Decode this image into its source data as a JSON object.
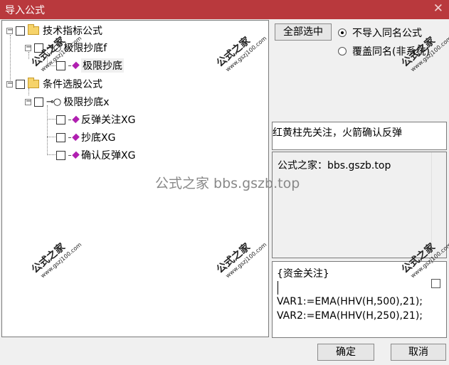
{
  "window": {
    "title": "导入公式",
    "close_glyph": "✕"
  },
  "tree": {
    "nodes": [
      {
        "label": "技术指标公式"
      },
      {
        "label": "极限抄底f"
      },
      {
        "label": "极限抄底"
      },
      {
        "label": "条件选股公式"
      },
      {
        "label": "极限抄底x"
      },
      {
        "label": "反弹关注XG"
      },
      {
        "label": "抄底XG"
      },
      {
        "label": "确认反弹XG"
      }
    ]
  },
  "buttons": {
    "select_all": "全部选中",
    "ok": "确定",
    "cancel": "取消"
  },
  "options": {
    "skip_same_name": "不导入同名公式",
    "overwrite_same_name": "覆盖同名(非系统)"
  },
  "description": "红黄柱先关注，火箭确认反弹",
  "info": "公式之家：bbs.gszb.top",
  "code": {
    "lines": [
      "{资金关注}",
      "VAR1:=EMA(HHV(H,500),21);",
      "VAR2:=EMA(HHV(H,250),21);"
    ]
  },
  "watermark": {
    "big": "公式之家",
    "small": "www.gszj100.com",
    "center": "公式之家 bbs.gszb.top"
  },
  "colors": {
    "titlebar": "#b9393d",
    "gem": "#b01fb0",
    "folder": "#f6d36a"
  }
}
